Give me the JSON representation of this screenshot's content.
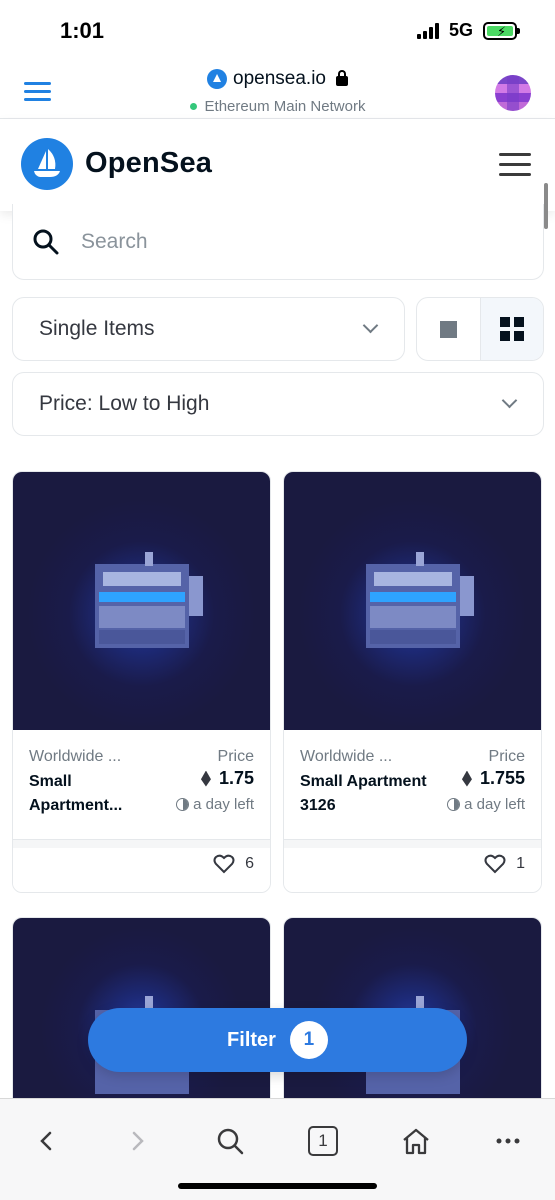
{
  "status_bar": {
    "time": "1:01",
    "network": "5G"
  },
  "browser": {
    "domain": "opensea.io",
    "network": "Ethereum Main Network"
  },
  "header": {
    "brand": "OpenSea"
  },
  "search": {
    "placeholder": "Search",
    "value": ""
  },
  "filters": {
    "type_select": "Single Items",
    "sort_select": "Price: Low to High"
  },
  "cards": [
    {
      "collection": "Worldwide ...",
      "name": "Small Apartment...",
      "price_label": "Price",
      "price": "1.75",
      "time_left": "a day left",
      "likes": "6"
    },
    {
      "collection": "Worldwide ...",
      "name": "Small Apartment 3126",
      "price_label": "Price",
      "price": "1.755",
      "time_left": "a day left",
      "likes": "1"
    }
  ],
  "filter_button": {
    "label": "Filter",
    "count": "1"
  },
  "bottom_bar": {
    "tabs_count": "1"
  },
  "colors": {
    "accent": "#2081e2",
    "filter_button": "#2d7ae0",
    "card_bg": "#1a1a40"
  }
}
